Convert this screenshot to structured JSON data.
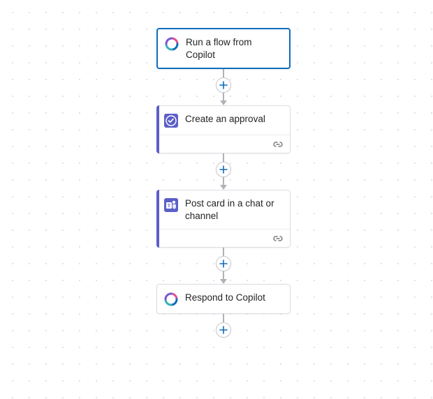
{
  "nodes": {
    "trigger": {
      "label": "Run a flow from Copilot"
    },
    "approval": {
      "label": "Create an approval"
    },
    "teams": {
      "label": "Post card in a chat or channel"
    },
    "respond": {
      "label": "Respond to Copilot"
    }
  },
  "icons": {
    "copilot": "copilot-icon",
    "approval": "approval-icon",
    "teams": "teams-icon",
    "link": "link-icon",
    "add": "add-step-icon"
  },
  "colors": {
    "selected_border": "#0f6cbd",
    "accent_bar": "#5b5fc7",
    "connector": "#b1b2b8"
  }
}
